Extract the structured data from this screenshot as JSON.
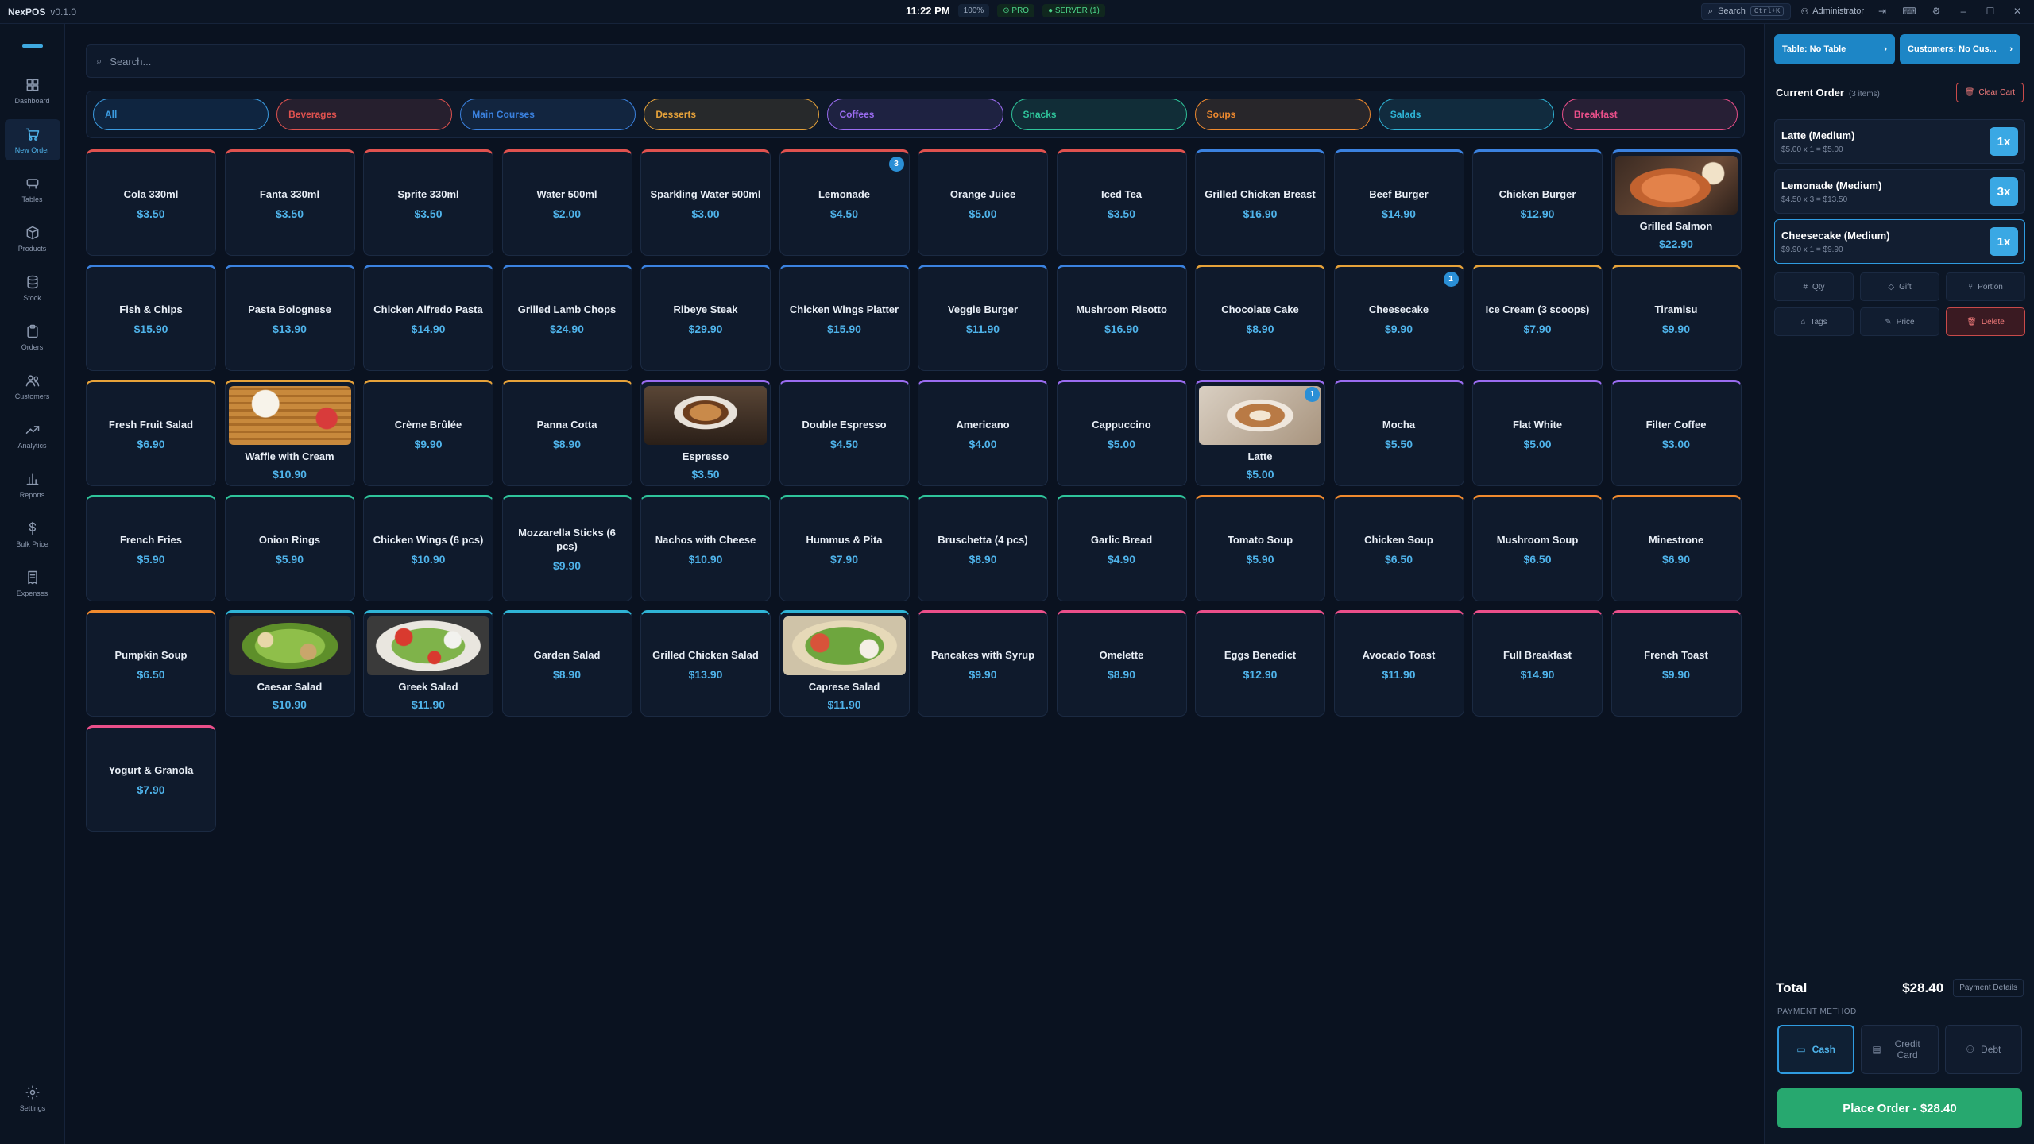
{
  "app": {
    "name": "NexPOS",
    "version": "v0.1.0"
  },
  "topbar": {
    "time": "11:22 PM",
    "zoom": "100%",
    "pro": "PRO",
    "server": "SERVER (1)",
    "search_label": "Search",
    "search_shortcut": "Ctrl+K",
    "user": "Administrator"
  },
  "sidebar": {
    "items": [
      {
        "label": "Dashboard",
        "icon": "dashboard-icon"
      },
      {
        "label": "New Order",
        "icon": "cart-icon"
      },
      {
        "label": "Tables",
        "icon": "table-icon"
      },
      {
        "label": "Products",
        "icon": "box-icon"
      },
      {
        "label": "Stock",
        "icon": "database-icon"
      },
      {
        "label": "Orders",
        "icon": "clipboard-icon"
      },
      {
        "label": "Customers",
        "icon": "users-icon"
      },
      {
        "label": "Analytics",
        "icon": "trend-icon"
      },
      {
        "label": "Reports",
        "icon": "bar-chart-icon"
      },
      {
        "label": "Bulk Price",
        "icon": "dollar-icon"
      },
      {
        "label": "Expenses",
        "icon": "receipt-icon"
      }
    ],
    "settings": "Settings"
  },
  "search": {
    "placeholder": "Search..."
  },
  "categories": [
    {
      "label": "All",
      "color": "#3b9be0"
    },
    {
      "label": "Beverages",
      "color": "#e0524f"
    },
    {
      "label": "Main Courses",
      "color": "#3b82e0"
    },
    {
      "label": "Desserts",
      "color": "#e6a23a"
    },
    {
      "label": "Coffees",
      "color": "#9a6cf0"
    },
    {
      "label": "Snacks",
      "color": "#2fc49a"
    },
    {
      "label": "Soups",
      "color": "#f08a2e"
    },
    {
      "label": "Salads",
      "color": "#2fb4d6"
    },
    {
      "label": "Breakfast",
      "color": "#ea4f8a"
    }
  ],
  "colors": {
    "Beverages": "#e0524f",
    "Main Courses": "#3b82e0",
    "Desserts": "#e6a23a",
    "Coffees": "#9a6cf0",
    "Snacks": "#2fc49a",
    "Soups": "#f08a2e",
    "Salads": "#2fb4d6",
    "Breakfast": "#ea4f8a"
  },
  "products": [
    {
      "name": "Cola 330ml",
      "price": "$3.50",
      "cat": "Beverages"
    },
    {
      "name": "Fanta 330ml",
      "price": "$3.50",
      "cat": "Beverages"
    },
    {
      "name": "Sprite 330ml",
      "price": "$3.50",
      "cat": "Beverages"
    },
    {
      "name": "Water 500ml",
      "price": "$2.00",
      "cat": "Beverages"
    },
    {
      "name": "Sparkling Water 500ml",
      "price": "$3.00",
      "cat": "Beverages"
    },
    {
      "name": "Lemonade",
      "price": "$4.50",
      "cat": "Beverages",
      "badge": "3"
    },
    {
      "name": "Orange Juice",
      "price": "$5.00",
      "cat": "Beverages"
    },
    {
      "name": "Iced Tea",
      "price": "$3.50",
      "cat": "Beverages"
    },
    {
      "name": "Grilled Chicken Breast",
      "price": "$16.90",
      "cat": "Main Courses"
    },
    {
      "name": "Beef Burger",
      "price": "$14.90",
      "cat": "Main Courses"
    },
    {
      "name": "Chicken Burger",
      "price": "$12.90",
      "cat": "Main Courses"
    },
    {
      "name": "Grilled Salmon",
      "price": "$22.90",
      "cat": "Main Courses",
      "img": "salmon"
    },
    {
      "name": "Fish & Chips",
      "price": "$15.90",
      "cat": "Main Courses"
    },
    {
      "name": "Pasta Bolognese",
      "price": "$13.90",
      "cat": "Main Courses"
    },
    {
      "name": "Chicken Alfredo Pasta",
      "price": "$14.90",
      "cat": "Main Courses"
    },
    {
      "name": "Grilled Lamb Chops",
      "price": "$24.90",
      "cat": "Main Courses"
    },
    {
      "name": "Ribeye Steak",
      "price": "$29.90",
      "cat": "Main Courses"
    },
    {
      "name": "Chicken Wings Platter",
      "price": "$15.90",
      "cat": "Main Courses"
    },
    {
      "name": "Veggie Burger",
      "price": "$11.90",
      "cat": "Main Courses"
    },
    {
      "name": "Mushroom Risotto",
      "price": "$16.90",
      "cat": "Main Courses"
    },
    {
      "name": "Chocolate Cake",
      "price": "$8.90",
      "cat": "Desserts"
    },
    {
      "name": "Cheesecake",
      "price": "$9.90",
      "cat": "Desserts",
      "badge": "1"
    },
    {
      "name": "Ice Cream (3 scoops)",
      "price": "$7.90",
      "cat": "Desserts"
    },
    {
      "name": "Tiramisu",
      "price": "$9.90",
      "cat": "Desserts"
    },
    {
      "name": "Fresh Fruit Salad",
      "price": "$6.90",
      "cat": "Desserts"
    },
    {
      "name": "Waffle with Cream",
      "price": "$10.90",
      "cat": "Desserts",
      "img": "waffle"
    },
    {
      "name": "Crème Brûlée",
      "price": "$9.90",
      "cat": "Desserts"
    },
    {
      "name": "Panna Cotta",
      "price": "$8.90",
      "cat": "Desserts"
    },
    {
      "name": "Espresso",
      "price": "$3.50",
      "cat": "Coffees",
      "img": "espresso"
    },
    {
      "name": "Double Espresso",
      "price": "$4.50",
      "cat": "Coffees"
    },
    {
      "name": "Americano",
      "price": "$4.00",
      "cat": "Coffees"
    },
    {
      "name": "Cappuccino",
      "price": "$5.00",
      "cat": "Coffees"
    },
    {
      "name": "Latte",
      "price": "$5.00",
      "cat": "Coffees",
      "img": "latte",
      "badge": "1"
    },
    {
      "name": "Mocha",
      "price": "$5.50",
      "cat": "Coffees"
    },
    {
      "name": "Flat White",
      "price": "$5.00",
      "cat": "Coffees"
    },
    {
      "name": "Filter Coffee",
      "price": "$3.00",
      "cat": "Coffees"
    },
    {
      "name": "French Fries",
      "price": "$5.90",
      "cat": "Snacks"
    },
    {
      "name": "Onion Rings",
      "price": "$5.90",
      "cat": "Snacks"
    },
    {
      "name": "Chicken Wings (6 pcs)",
      "price": "$10.90",
      "cat": "Snacks"
    },
    {
      "name": "Mozzarella Sticks (6 pcs)",
      "price": "$9.90",
      "cat": "Snacks"
    },
    {
      "name": "Nachos with Cheese",
      "price": "$10.90",
      "cat": "Snacks"
    },
    {
      "name": "Hummus & Pita",
      "price": "$7.90",
      "cat": "Snacks"
    },
    {
      "name": "Bruschetta (4 pcs)",
      "price": "$8.90",
      "cat": "Snacks"
    },
    {
      "name": "Garlic Bread",
      "price": "$4.90",
      "cat": "Snacks"
    },
    {
      "name": "Tomato Soup",
      "price": "$5.90",
      "cat": "Soups"
    },
    {
      "name": "Chicken Soup",
      "price": "$6.50",
      "cat": "Soups"
    },
    {
      "name": "Mushroom Soup",
      "price": "$6.50",
      "cat": "Soups"
    },
    {
      "name": "Minestrone",
      "price": "$6.90",
      "cat": "Soups"
    },
    {
      "name": "Pumpkin Soup",
      "price": "$6.50",
      "cat": "Soups"
    },
    {
      "name": "Caesar Salad",
      "price": "$10.90",
      "cat": "Salads",
      "img": "caesar"
    },
    {
      "name": "Greek Salad",
      "price": "$11.90",
      "cat": "Salads",
      "img": "greek"
    },
    {
      "name": "Garden Salad",
      "price": "$8.90",
      "cat": "Salads"
    },
    {
      "name": "Grilled Chicken Salad",
      "price": "$13.90",
      "cat": "Salads"
    },
    {
      "name": "Caprese Salad",
      "price": "$11.90",
      "cat": "Salads",
      "img": "caprese"
    },
    {
      "name": "Pancakes with Syrup",
      "price": "$9.90",
      "cat": "Breakfast"
    },
    {
      "name": "Omelette",
      "price": "$8.90",
      "cat": "Breakfast"
    },
    {
      "name": "Eggs Benedict",
      "price": "$12.90",
      "cat": "Breakfast"
    },
    {
      "name": "Avocado Toast",
      "price": "$11.90",
      "cat": "Breakfast"
    },
    {
      "name": "Full Breakfast",
      "price": "$14.90",
      "cat": "Breakfast"
    },
    {
      "name": "French Toast",
      "price": "$9.90",
      "cat": "Breakfast"
    },
    {
      "name": "Yogurt & Granola",
      "price": "$7.90",
      "cat": "Breakfast"
    }
  ],
  "right": {
    "table_btn": "Table: No Table",
    "customer_btn": "Customers: No Cus...",
    "title": "Current Order",
    "count": "(3 items)",
    "clear": "Clear Cart",
    "items": [
      {
        "name": "Latte (Medium)",
        "sub": "$5.00 x 1 = $5.00",
        "qty": "1x"
      },
      {
        "name": "Lemonade (Medium)",
        "sub": "$4.50 x 3 = $13.50",
        "qty": "3x"
      },
      {
        "name": "Cheesecake (Medium)",
        "sub": "$9.90 x 1 = $9.90",
        "qty": "1x"
      }
    ],
    "actions": [
      "Qty",
      "Gift",
      "Portion",
      "Tags",
      "Price",
      "Delete"
    ],
    "total_label": "Total",
    "total_value": "$28.40",
    "payment_details": "Payment Details",
    "payment_method_label": "PAYMENT METHOD",
    "methods": [
      "Cash",
      "Credit Card",
      "Debt"
    ],
    "place_order": "Place Order - $28.40"
  }
}
